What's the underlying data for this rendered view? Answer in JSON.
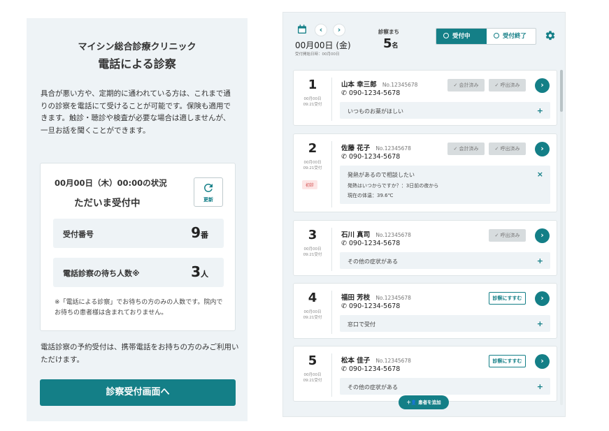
{
  "left": {
    "clinic_name": "マイシン総合診療クリニック",
    "title": "電話による診察",
    "description": "具合が悪い方や、定期的に通われている方は、これまで通りの診察を電話にて受けることが可能です。保険も適用できます。触診・聴診や検査が必要な場合は適しませんが、一旦お話を聞くことができます。",
    "status": {
      "datetime": "00月00日（木）00:00の状況",
      "now": "ただいま受付中",
      "refresh_label": "更新",
      "reception_label": "受付番号",
      "reception_number": "9",
      "reception_unit": "番",
      "waiting_label": "電話診察の待ち人数※",
      "waiting_number": "3",
      "waiting_unit": "人",
      "note": "※「電話による診察」でお待ちの方のみの人数です。院内でお待ちの患者様は含まれておりません。"
    },
    "description2": "電話診察の予約受付は、携帯電話をお持ちの方のみご利用いただけます。",
    "cta_label": "診察受付画面へ"
  },
  "right": {
    "date": "00月00日 (金)",
    "date_sub": "受付開始日時：00月00日",
    "wait_label": "診察まち",
    "wait_count": "5",
    "wait_unit": "名",
    "toggle_on": "受付中",
    "toggle_off": "受付終了",
    "add_patient": "患者を追加",
    "patients": [
      {
        "num": "1",
        "date": "00月00日",
        "time": "09:21受付",
        "name": "山本 幸三郎",
        "pid": "No.12345678",
        "tel": "090-1234-5678",
        "btn1": "会計済み",
        "btn2": "呼出済み",
        "note": "いつものお薬がほしい",
        "note_action": "+"
      },
      {
        "num": "2",
        "date": "00月00日",
        "time": "09:21受付",
        "badge": "初診",
        "name": "佐藤 花子",
        "pid": "No.12345678",
        "tel": "090-1234-5678",
        "btn1": "会計済み",
        "btn2": "呼出済み",
        "note": "発熱があるので相談したい",
        "note_action": "×",
        "note_sub1": "発熱はいつからですか？：3日前の夜から",
        "note_sub2": "現在の体温：39.6℃"
      },
      {
        "num": "3",
        "date": "00月00日",
        "time": "09:21受付",
        "name": "石川 真司",
        "pid": "No.12345678",
        "tel": "090-1234-5678",
        "btn2": "呼出済み",
        "note": "その他の症状がある",
        "note_action": "+"
      },
      {
        "num": "4",
        "date": "00月00日",
        "time": "09:21受付",
        "name": "福田 芳枝",
        "pid": "No.12345678",
        "tel": "090-1234-5678",
        "btn_call": "診察にすすむ",
        "note": "窓口で受付",
        "note_action": "+"
      },
      {
        "num": "5",
        "date": "00月00日",
        "time": "09:21受付",
        "name": "松本 佳子",
        "pid": "No.12345678",
        "tel": "090-1234-5678",
        "btn_call": "診察にすすむ",
        "note": "その他の症状がある",
        "note_action": "+"
      }
    ]
  },
  "colors": {
    "accent": "#147f87",
    "panel_bg": "#eef3f6"
  },
  "icons": [
    "refresh-icon",
    "calendar-icon",
    "chevron-left-icon",
    "chevron-right-icon",
    "gear-icon",
    "phone-icon",
    "check-icon",
    "arrow-right-icon",
    "add-person-icon"
  ]
}
